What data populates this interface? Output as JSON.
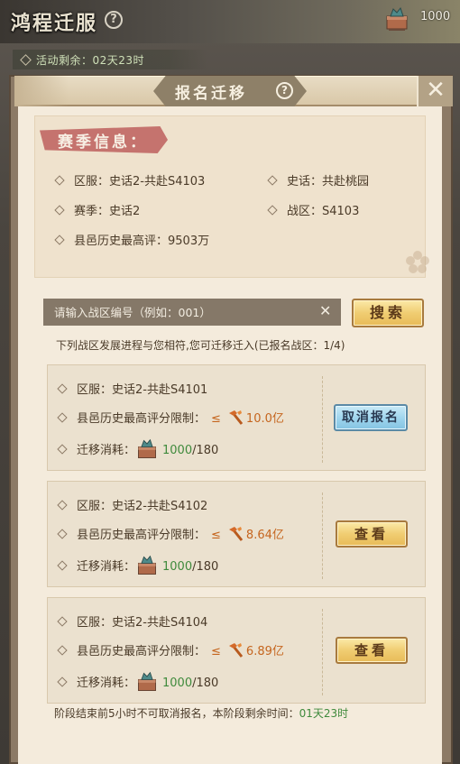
{
  "top": {
    "title": "鸿程迁服",
    "help": "?",
    "resource_icon": "migration-chest-icon",
    "resource_count": "1000"
  },
  "timer": {
    "label": "活动剩余：02天23时"
  },
  "dialog": {
    "title": "报名迁移",
    "help": "?",
    "close": "✕"
  },
  "season": {
    "tag": "赛季信息：",
    "server": "区服：史话2-共赴S4103",
    "history": "史话：共赴桃园",
    "season": "赛季：史话2",
    "zone": "战区：S4103",
    "best": "县邑历史最高评：9503万"
  },
  "search": {
    "placeholder": "请输入战区编号（例如：001）",
    "clear": "✕",
    "button": "搜索"
  },
  "hint": "下列战区发展进程与您相符,您可迁移迁入(已报名战区：1/4)",
  "servers": [
    {
      "server": "区服：史话2-共赴S4101",
      "limit_label": "县邑历史最高评分限制：",
      "leq": "≤",
      "limit_value": "10.0亿",
      "cost_label": "迁移消耗：",
      "cost_have": "1000",
      "cost_need": "/180",
      "button": "取消报名",
      "button_style": "blue"
    },
    {
      "server": "区服：史话2-共赴S4102",
      "limit_label": "县邑历史最高评分限制：",
      "leq": "≤",
      "limit_value": "8.64亿",
      "cost_label": "迁移消耗：",
      "cost_have": "1000",
      "cost_need": "/180",
      "button": "查看",
      "button_style": "gold"
    },
    {
      "server": "区服：史话2-共赴S4104",
      "limit_label": "县邑历史最高评分限制：",
      "leq": "≤",
      "limit_value": "6.89亿",
      "cost_label": "迁移消耗：",
      "cost_have": "1000",
      "cost_need": "/180",
      "button": "查看",
      "button_style": "gold"
    }
  ],
  "footer": {
    "text": "阶段结束前5小时不可取消报名，本阶段剩余时间：",
    "time": "01天23时"
  },
  "colors": {
    "panel_bg": "#f4ebdc",
    "accent_orange": "#c5651e",
    "accent_green": "#3f8a3c",
    "tag_red": "#c5736e",
    "gold_button": "#f0cd72",
    "blue_button": "#9ad2ec"
  }
}
